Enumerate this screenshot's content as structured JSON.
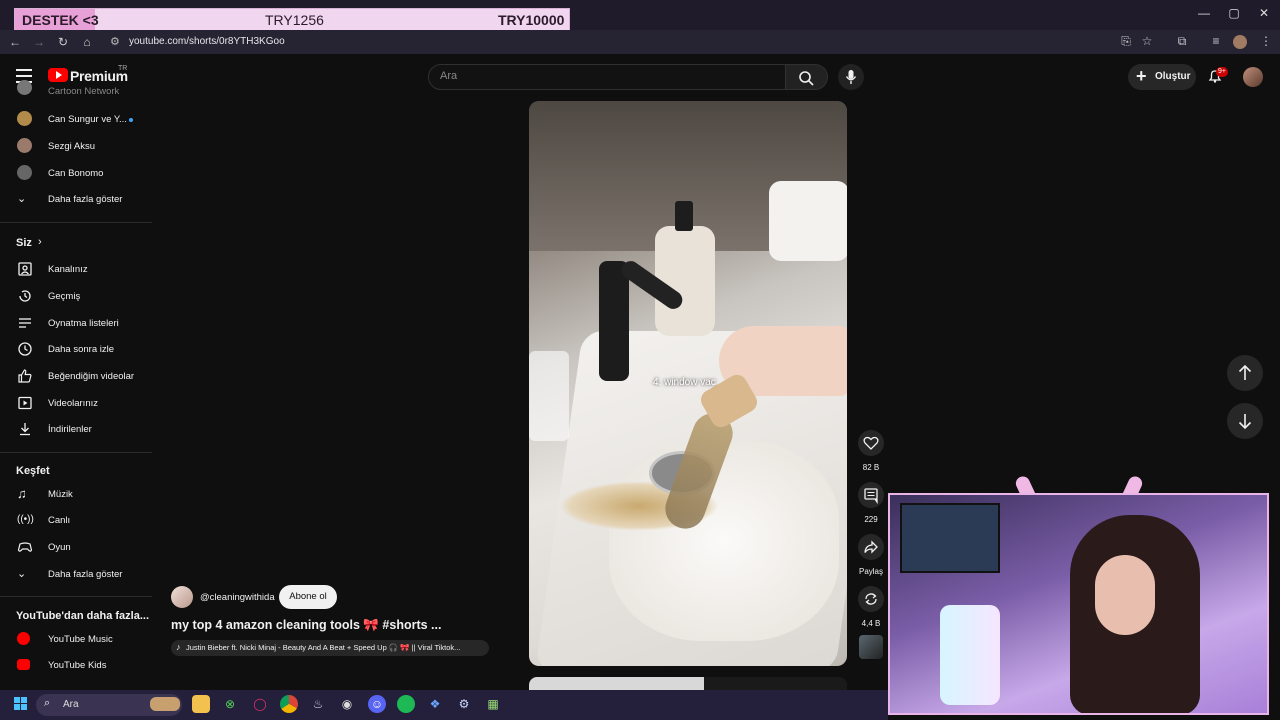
{
  "overlay": {
    "support": "DESTEK <3",
    "goal_current": "TRY1256",
    "goal_target": "TRY10000"
  },
  "browser": {
    "url": "youtube.com/shorts/0r8YTH3KGoo"
  },
  "header": {
    "brand": "Premium",
    "region": "TR",
    "search_placeholder": "Ara",
    "create_label": "Oluştur",
    "notif_count": "9+"
  },
  "sidebar": {
    "subscriptions": [
      {
        "label": "Cartoon Network",
        "dot": true
      },
      {
        "label": "Can Sungur ve Y...",
        "dot": true
      },
      {
        "label": "Sezgi Aksu",
        "dot": false
      },
      {
        "label": "Can Bonomo",
        "dot": false
      }
    ],
    "show_more": "Daha fazla göster",
    "you_heading": "Siz",
    "you_items": [
      "Kanalınız",
      "Geçmiş",
      "Oynatma listeleri",
      "Daha sonra izle",
      "Beğendiğim videolar",
      "Videolarınız",
      "İndirilenler"
    ],
    "explore_heading": "Keşfet",
    "explore_items": [
      "Müzik",
      "Canlı",
      "Oyun"
    ],
    "show_more_2": "Daha fazla göster",
    "more_heading": "YouTube'dan daha fazla...",
    "more_items": [
      "YouTube Music",
      "YouTube Kids"
    ]
  },
  "video": {
    "caption": "4. window vac",
    "channel": "@cleaningwithida",
    "subscribe": "Abone ol",
    "title": "my top 4 amazon cleaning tools 🎀 #shorts ...",
    "music": "Justin Bieber ft. Nicki Minaj - Beauty And A Beat + Speed Up 🎧 🎀 || Viral Tiktok..."
  },
  "actions": {
    "likes": "82 B",
    "comments": "229",
    "share": "Paylaş",
    "remix": "4,4 B"
  },
  "taskbar": {
    "search_label": "Ara"
  },
  "colors": {
    "brand_red": "#ff0000",
    "accent_blue": "#3ea6ff",
    "overlay_pink": "#f0d7ef"
  }
}
